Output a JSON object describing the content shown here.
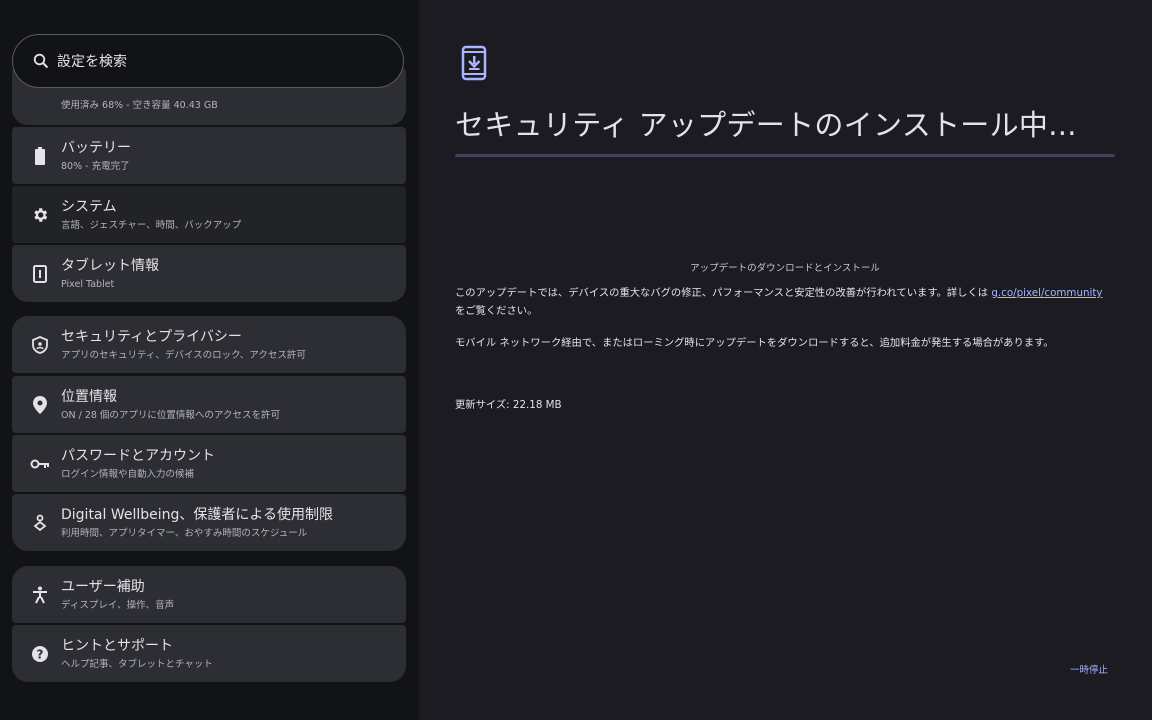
{
  "search": {
    "placeholder": "設定を検索"
  },
  "settings_list": {
    "storage": {
      "subtitle": "使用済み 68% - 空き容量 40.43 GB"
    },
    "battery": {
      "title": "バッテリー",
      "subtitle": "80% - 充電完了"
    },
    "system": {
      "title": "システム",
      "subtitle": "言語、ジェスチャー、時間、バックアップ"
    },
    "about": {
      "title": "タブレット情報",
      "subtitle": "Pixel Tablet"
    },
    "security": {
      "title": "セキュリティとプライバシー",
      "subtitle": "アプリのセキュリティ、デバイスのロック、アクセス許可"
    },
    "location": {
      "title": "位置情報",
      "subtitle": "ON / 28 個のアプリに位置情報へのアクセスを許可"
    },
    "passwords": {
      "title": "パスワードとアカウント",
      "subtitle": "ログイン情報や自動入力の候補"
    },
    "wellbeing": {
      "title": "Digital Wellbeing、保護者による使用制限",
      "subtitle": "利用時間、アプリタイマー、おやすみ時間のスケジュール"
    },
    "accessibility": {
      "title": "ユーザー補助",
      "subtitle": "ディスプレイ、操作、音声"
    },
    "help": {
      "title": "ヒントとサポート",
      "subtitle": "ヘルプ記事、タブレットとチャット"
    }
  },
  "update_panel": {
    "icon": "phone-download-icon",
    "title": "セキュリティ アップデートのインストール中...",
    "progress": 0,
    "section_title": "アップデートのダウンロードとインストール",
    "description_before_link": "このアップデートでは、デバイスの重大なバグの修正、パフォーマンスと安定性の改善が行われています。詳しくは ",
    "description_link": "g.co/pixel/community",
    "description_after_link": " をご覧ください。",
    "network_note": "モバイル ネットワーク経由で、またはローミング時にアップデートをダウンロードすると、追加料金が発生する場合があります。",
    "update_size": "更新サイズ: 22.18 MB",
    "pause_label": "一時停止"
  },
  "colors": {
    "accent": "#aab4ff",
    "panel_bg": "#1b1b21",
    "list_bg": "#121316",
    "card_bg": "#2d2e33"
  }
}
